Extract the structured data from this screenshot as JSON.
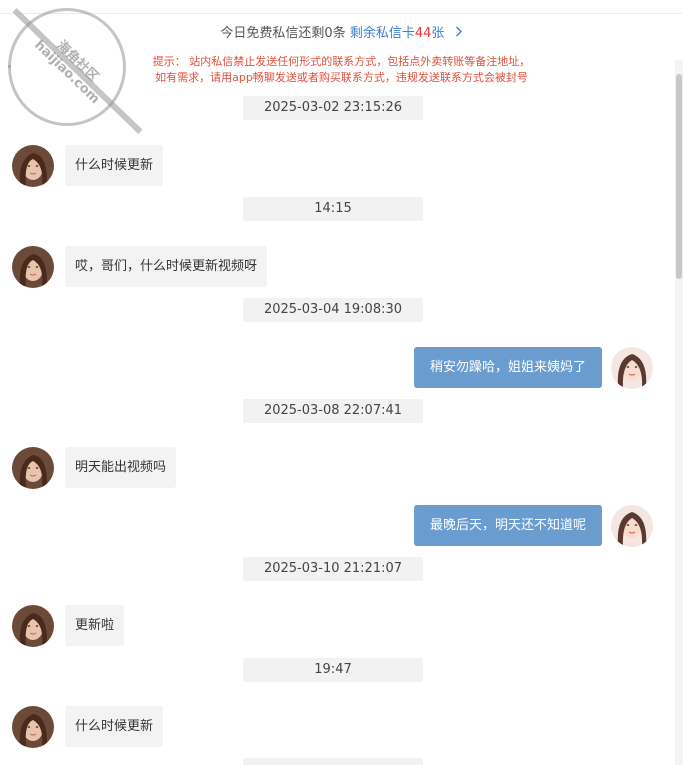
{
  "header": {
    "quota_text": "今日免费私信还剩0条",
    "card_prefix": "剩余私信卡",
    "card_count": "44",
    "card_suffix": "张",
    "chevron": ">"
  },
  "notice": {
    "line1": "提示： 站内私信禁止发送任何形式的联系方式，包括点外卖转账等备注地址，",
    "line2": "如有需求，请用app畅聊发送或者购买联系方式，违规发送联系方式会被封号"
  },
  "watermark": {
    "text_line1": "海角社区",
    "text_line2": "haijiao.com"
  },
  "messages": [
    {
      "kind": "time",
      "text": "2025-03-02 23:15:26"
    },
    {
      "kind": "in",
      "text": "什么时候更新"
    },
    {
      "kind": "time",
      "text": "14:15"
    },
    {
      "kind": "in",
      "text": "哎，哥们，什么时候更新视频呀"
    },
    {
      "kind": "time",
      "text": "2025-03-04 19:08:30"
    },
    {
      "kind": "out",
      "text": "稍安勿躁哈，姐姐来姨妈了"
    },
    {
      "kind": "time",
      "text": "2025-03-08 22:07:41"
    },
    {
      "kind": "in",
      "text": "明天能出视频吗"
    },
    {
      "kind": "out",
      "text": "最晚后天，明天还不知道呢"
    },
    {
      "kind": "time",
      "text": "2025-03-10 21:21:07"
    },
    {
      "kind": "in",
      "text": "更新啦"
    },
    {
      "kind": "time",
      "text": "19:47"
    },
    {
      "kind": "in",
      "text": "什么时候更新"
    }
  ]
}
